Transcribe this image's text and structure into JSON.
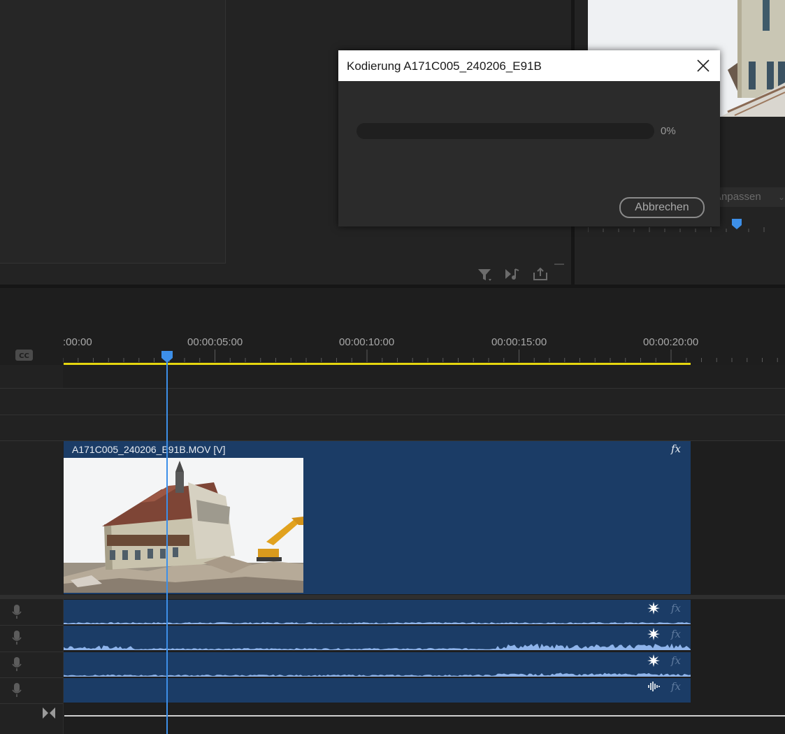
{
  "program_monitor": {
    "fit_label": "Anpassen"
  },
  "dialog": {
    "title": "Kodierung A171C005_240206_E91B",
    "progress_percent": 0,
    "progress_label": "0%",
    "cancel_label": "Abbrechen"
  },
  "timeline": {
    "timecodes": [
      ":00:00",
      "00:00:05:00",
      "00:00:10:00",
      "00:00:15:00",
      "00:00:20:00"
    ],
    "video_clip": {
      "name": "A171C005_240206_E91B.MOV [V]",
      "fx_label": "fx"
    },
    "audio_clips": [
      {
        "fx_label": "fx",
        "badge": "burst-icon"
      },
      {
        "fx_label": "fx",
        "badge": "burst-icon"
      },
      {
        "fx_label": "fx",
        "badge": "burst-icon"
      },
      {
        "fx_label": "fx",
        "badge": "waveform-icon"
      }
    ]
  },
  "colors": {
    "clip": "#1b3c66",
    "playhead": "#3d8fe8",
    "work_area": "#e6d60f"
  }
}
